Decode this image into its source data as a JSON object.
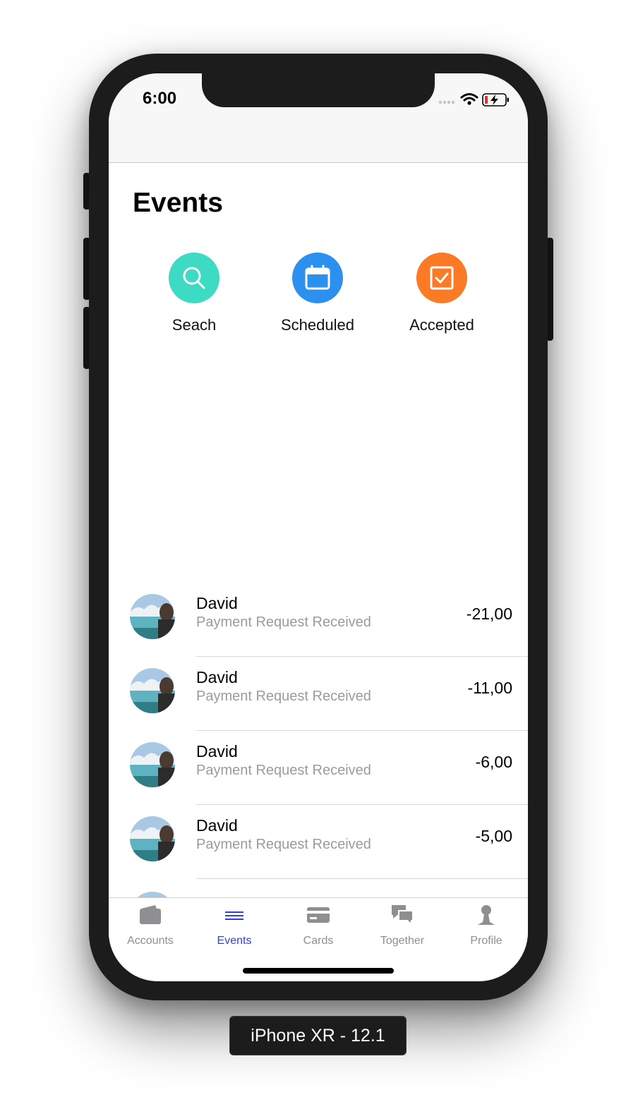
{
  "status_bar": {
    "time": "6:00"
  },
  "page": {
    "title": "Events"
  },
  "actions": [
    {
      "label": "Seach",
      "icon": "search-icon",
      "color": "#3ddac4"
    },
    {
      "label": "Scheduled",
      "icon": "calendar-icon",
      "color": "#2b90ee"
    },
    {
      "label": "Accepted",
      "icon": "checkbox-icon",
      "color": "#fb7a25"
    }
  ],
  "events": [
    {
      "name": "David",
      "subtitle": "Payment Request Received",
      "amount": "-21,00"
    },
    {
      "name": "David",
      "subtitle": "Payment Request Received",
      "amount": "-11,00"
    },
    {
      "name": "David",
      "subtitle": "Payment Request Received",
      "amount": "-6,00"
    },
    {
      "name": "David",
      "subtitle": "Payment Request Received",
      "amount": "-5,00"
    }
  ],
  "tabs": [
    {
      "label": "Accounts",
      "icon": "wallet-icon",
      "active": false
    },
    {
      "label": "Events",
      "icon": "list-icon",
      "active": true
    },
    {
      "label": "Cards",
      "icon": "card-icon",
      "active": false
    },
    {
      "label": "Together",
      "icon": "chat-bubbles-icon",
      "active": false
    },
    {
      "label": "Profile",
      "icon": "person-icon",
      "active": false
    }
  ],
  "colors": {
    "tab_active": "#2f3fd8",
    "tab_inactive": "#8e8e93"
  },
  "device_label": "iPhone XR - 12.1"
}
